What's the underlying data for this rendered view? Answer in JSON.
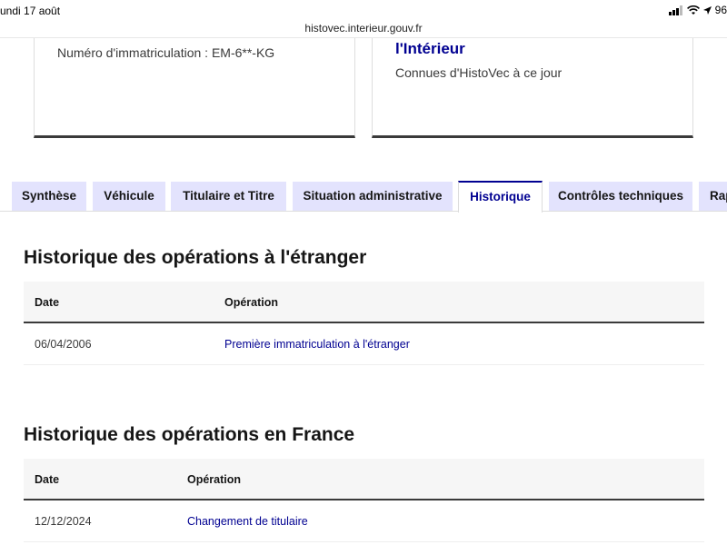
{
  "status_bar": {
    "date": "undi 17 août",
    "battery": "96"
  },
  "browser": {
    "url": "histovec.interieur.gouv.fr"
  },
  "cards": {
    "left": {
      "text": "Numéro d'immatriculation : EM-6**-KG"
    },
    "right": {
      "heading": "l'Intérieur",
      "subtext": "Connues d'HistoVec à ce jour"
    }
  },
  "tabs": [
    {
      "label": "Synthèse"
    },
    {
      "label": "Véhicule"
    },
    {
      "label": "Titulaire et Titre"
    },
    {
      "label": "Situation administrative"
    },
    {
      "label": "Historique"
    },
    {
      "label": "Contrôles techniques"
    },
    {
      "label": "Rap"
    }
  ],
  "active_tab": "Historique",
  "sections": [
    {
      "title": "Historique des opérations à l'étranger",
      "headers": {
        "date": "Date",
        "operation": "Opération"
      },
      "rows": [
        {
          "date": "06/04/2006",
          "operation": "Première immatriculation à l'étranger"
        }
      ]
    },
    {
      "title": "Historique des opérations en France",
      "headers": {
        "date": "Date",
        "operation": "Opération"
      },
      "rows": [
        {
          "date": "12/12/2024",
          "operation": "Changement de titulaire"
        }
      ]
    }
  ],
  "colors": {
    "accent": "#000091",
    "tab_inactive_bg": "#e3e3fd",
    "table_header_bg": "#f6f6f6"
  }
}
